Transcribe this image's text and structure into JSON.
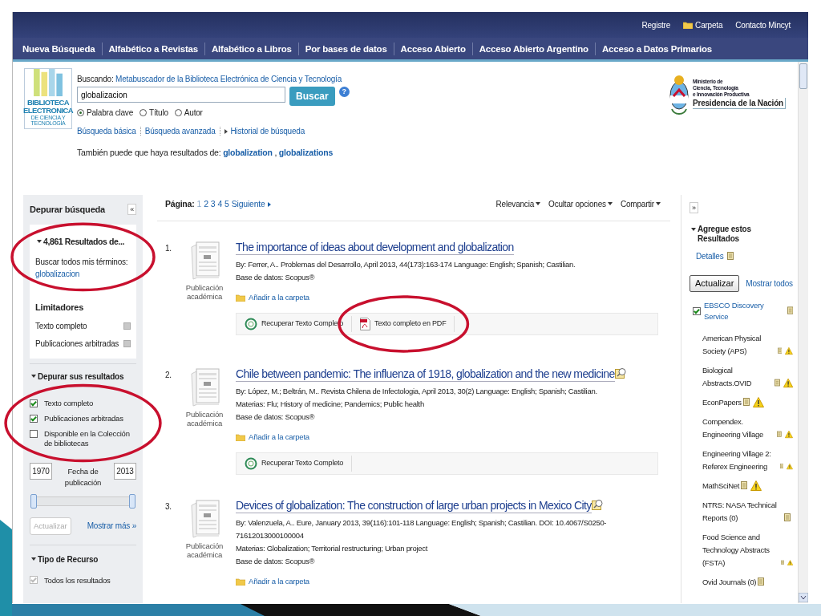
{
  "top_links": [
    {
      "label": "Registre",
      "kind": "plain"
    },
    {
      "label": "Carpeta",
      "kind": "folder"
    },
    {
      "label": "Contacto Mincyt",
      "kind": "plain"
    }
  ],
  "nav": [
    "Nueva Búsqueda",
    "Alfabético a Revistas",
    "Alfabético a Libros",
    "Por bases de datos",
    "Acceso Abierto",
    "Acceso Abierto Argentino",
    "Acceso a Datos Primarios"
  ],
  "header": {
    "logo_lines": [
      "BIBLIOTECA",
      "ELECTRONICA",
      "DE CIENCIA Y TECNOLOGÍA"
    ],
    "searching_label": "Buscando:",
    "searching_target": "Metabuscador de la Biblioteca Electrónica de Ciencia y Tecnología",
    "query": "globalizacion",
    "search_button": "Buscar",
    "help": "?",
    "radios": [
      {
        "label": "Palabra clave",
        "selected": true
      },
      {
        "label": "Título",
        "selected": false
      },
      {
        "label": "Autor",
        "selected": false
      }
    ],
    "links": [
      "Búsqueda básica",
      "Búsqueda avanzada",
      "Historial de búsqueda"
    ],
    "suggest_label": "También puede que haya resultados de:",
    "suggestions": [
      "globalization",
      "globalizations"
    ],
    "suggest_separator": ",",
    "ministry_lines": [
      "Ministerio de",
      "Ciencia, Tecnología",
      "e Innovación Productiva"
    ],
    "ministry_title": "Presidencia de la Nación"
  },
  "left_panel": {
    "title": "Depurar búsqueda",
    "collapse": "«",
    "results": "4,861 Resultados de...",
    "all_terms_label": "Buscar todos mis términos:",
    "term": "globalizacion",
    "limiters_title": "Limitadores",
    "limiters": [
      "Texto completo",
      "Publicaciones arbitradas"
    ],
    "refine_title": "Depurar sus resultados",
    "refine": [
      {
        "label": "Texto completo",
        "checked": true
      },
      {
        "label": "Publicaciones arbitradas",
        "checked": true
      },
      {
        "label": "Disponible en la Colección de bibliotecas",
        "checked": false
      }
    ],
    "date_from": "1970",
    "date_label": "Fecha de publicación",
    "date_to": "2013",
    "update_button": {
      "label": "Actualizar",
      "disabled": true
    },
    "more": "Mostrar más »",
    "type_title": "Tipo de Recurso",
    "types": [
      {
        "label": "Todos los resultados",
        "checked": true,
        "disabled": true
      }
    ]
  },
  "toolbar": {
    "page_label": "Página:",
    "pages": [
      {
        "label": "1",
        "selected": true
      },
      {
        "label": "2",
        "selected": false
      },
      {
        "label": "3",
        "selected": false
      },
      {
        "label": "4",
        "selected": false
      },
      {
        "label": "5",
        "selected": false
      }
    ],
    "next": "Siguiente",
    "menus": [
      "Relevancia",
      "Ocultar opciones",
      "Compartir"
    ]
  },
  "results": [
    {
      "number": "1.",
      "type": "Publicación académica",
      "title": "The importance of ideas about development and globalization",
      "preview": false,
      "lines": [
        "By: Ferrer, A.. Problemas del Desarrollo, April 2013, 44(173):163-174 Language: English; Spanish; Castilian.",
        "Base de datos: Scopus®"
      ],
      "add": "Añadir a la carpeta",
      "links": [
        {
          "kind": "ls",
          "label": "Recuperar Texto Completo"
        },
        {
          "kind": "pdf",
          "label": "Texto completo en PDF"
        }
      ]
    },
    {
      "number": "2.",
      "type": "Publicación académica",
      "title": "Chile between pandemic: The influenza of 1918, globalization and the new medicine",
      "preview": true,
      "lines": [
        "By: López, M.; Beltrán, M.. Revista Chilena de Infectologia, April 2013, 30(2) Language: English; Spanish; Castilian.",
        "Materias: Flu; History of medicine; Pandemics; Public health",
        "Base de datos: Scopus®"
      ],
      "add": "Añadir a la carpeta",
      "links": [
        {
          "kind": "ls",
          "label": "Recuperar Texto Completo"
        }
      ]
    },
    {
      "number": "3.",
      "type": "Publicación académica",
      "title": "Devices of globalization: The construction of large urban projects in Mexico City",
      "preview": true,
      "lines": [
        "By: Valenzuela, A.. Eure, January 2013, 39(116):101-118 Language: English; Spanish; Castilian. DOI: 10.4067/S0250-71612013000100004",
        "Materias: Globalization; Territorial restructuring; Urban project",
        "Base de datos: Scopus®"
      ],
      "add": "Añadir a la carpeta"
    }
  ],
  "right_panel": {
    "expand": "»",
    "title": "Agregue estos Resultados",
    "details": "Detalles",
    "update_button": "Actualizar",
    "show_all": "Mostrar todos",
    "sources": [
      {
        "kind": "checkbox",
        "label": "EBSCO Discovery Service",
        "checked": true,
        "warning": false
      },
      {
        "kind": "plain",
        "label": "American Physical Society (APS)",
        "warning": true
      },
      {
        "kind": "plain",
        "label": "Biological Abstracts.OVID",
        "warning": true
      },
      {
        "kind": "plain",
        "label": "EconPapers",
        "warning": true
      },
      {
        "kind": "plain",
        "label": "Compendex. Engineering Village",
        "warning": true
      },
      {
        "kind": "plain",
        "label": "Engineering Village 2: Referex Engineering",
        "warning": true
      },
      {
        "kind": "plain",
        "label": "MathSciNet",
        "warning": true
      },
      {
        "kind": "plain",
        "label": "NTRS: NASA Technical Reports (0)",
        "warning": false
      },
      {
        "kind": "plain",
        "label": "Food Science and Technology Abstracts (FSTA)",
        "warning": true
      },
      {
        "kind": "plain",
        "label": "Ovid Journals (0)",
        "warning": false
      }
    ]
  }
}
